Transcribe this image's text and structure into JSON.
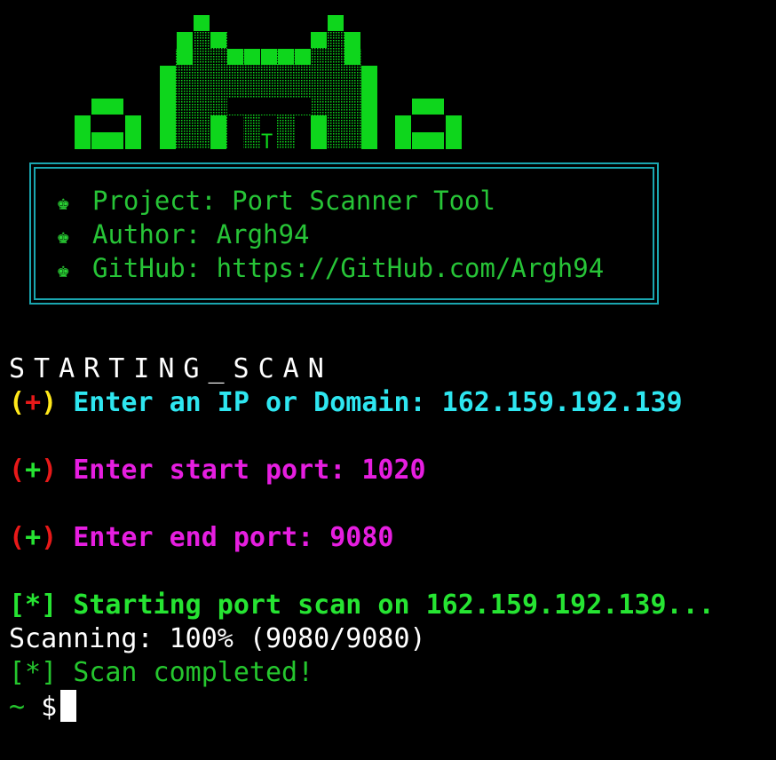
{
  "banner": {
    "logo_mark": "T",
    "info": {
      "project": "Project: Port Scanner Tool",
      "author": "Author: Argh94",
      "github": "GitHub: https://GitHub.com/Argh94"
    }
  },
  "terminal": {
    "header": "STARTING_SCAN",
    "prompt_marker": {
      "open": "(",
      "plus": "+",
      "close": ")"
    },
    "ip_prompt": "Enter an IP or Domain:",
    "ip_value": "162.159.192.139",
    "start_prompt": "Enter start port:",
    "start_value": "1020",
    "end_prompt": "Enter end port:",
    "end_value": "9080",
    "start_msg": "[*] Starting port scan on 162.159.192.139...",
    "progress_label": "Scanning:",
    "progress_value": "100% (9080/9080)",
    "progress_fraction": 1.0,
    "complete_msg": "[*] Scan completed!",
    "shell_tilde": "~",
    "shell_dollar": "$"
  },
  "colors": {
    "background": "#000000",
    "art_green": "#0ed61c",
    "box_border": "#1aa6b0",
    "cyan": "#2ee6f0",
    "magenta": "#e61ee0",
    "green": "#26e432",
    "red": "#e81919",
    "yellow": "#ffe81a"
  },
  "icons": {
    "info_bullet": "crown-icon"
  }
}
